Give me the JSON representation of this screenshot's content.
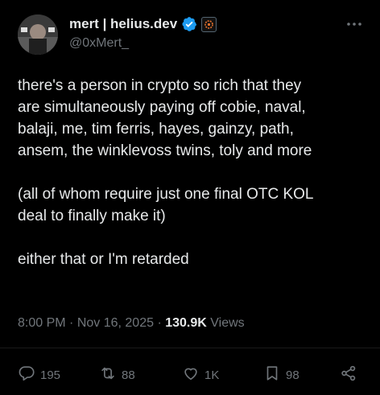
{
  "author": {
    "display_name": "mert | helius.dev",
    "handle": "@0xMert_"
  },
  "icons": {
    "verified": "verified-badge-icon",
    "affiliate": "helius-affiliate-icon",
    "more": "more-horizontal-icon",
    "reply": "reply-icon",
    "repost": "repost-icon",
    "like": "like-icon",
    "bookmark": "bookmark-icon",
    "share": "share-icon"
  },
  "colors": {
    "verified": "#1d9bf0",
    "affiliate": "#e8722c",
    "background": "#000000",
    "text": "#e7e9ea",
    "muted": "#71767b"
  },
  "tweet": {
    "paragraph1": [
      "there's a person in crypto so rich that they",
      "are simultaneously paying off cobie, naval,",
      "balaji, me, tim ferris, hayes, gainzy, path,",
      "ansem, the winklevoss twins, toly and more"
    ],
    "paragraph2": [
      "(all of whom require just one final OTC KOL",
      "deal to finally make it)"
    ],
    "paragraph3": [
      "either that or I'm retarded"
    ]
  },
  "meta": {
    "time": "8:00 PM",
    "separator": " · ",
    "date": "Nov 16, 2025",
    "views_count": "130.9K",
    "views_label": " Views"
  },
  "actions": {
    "replies": "195",
    "reposts": "88",
    "likes": "1K",
    "bookmarks": "98"
  }
}
